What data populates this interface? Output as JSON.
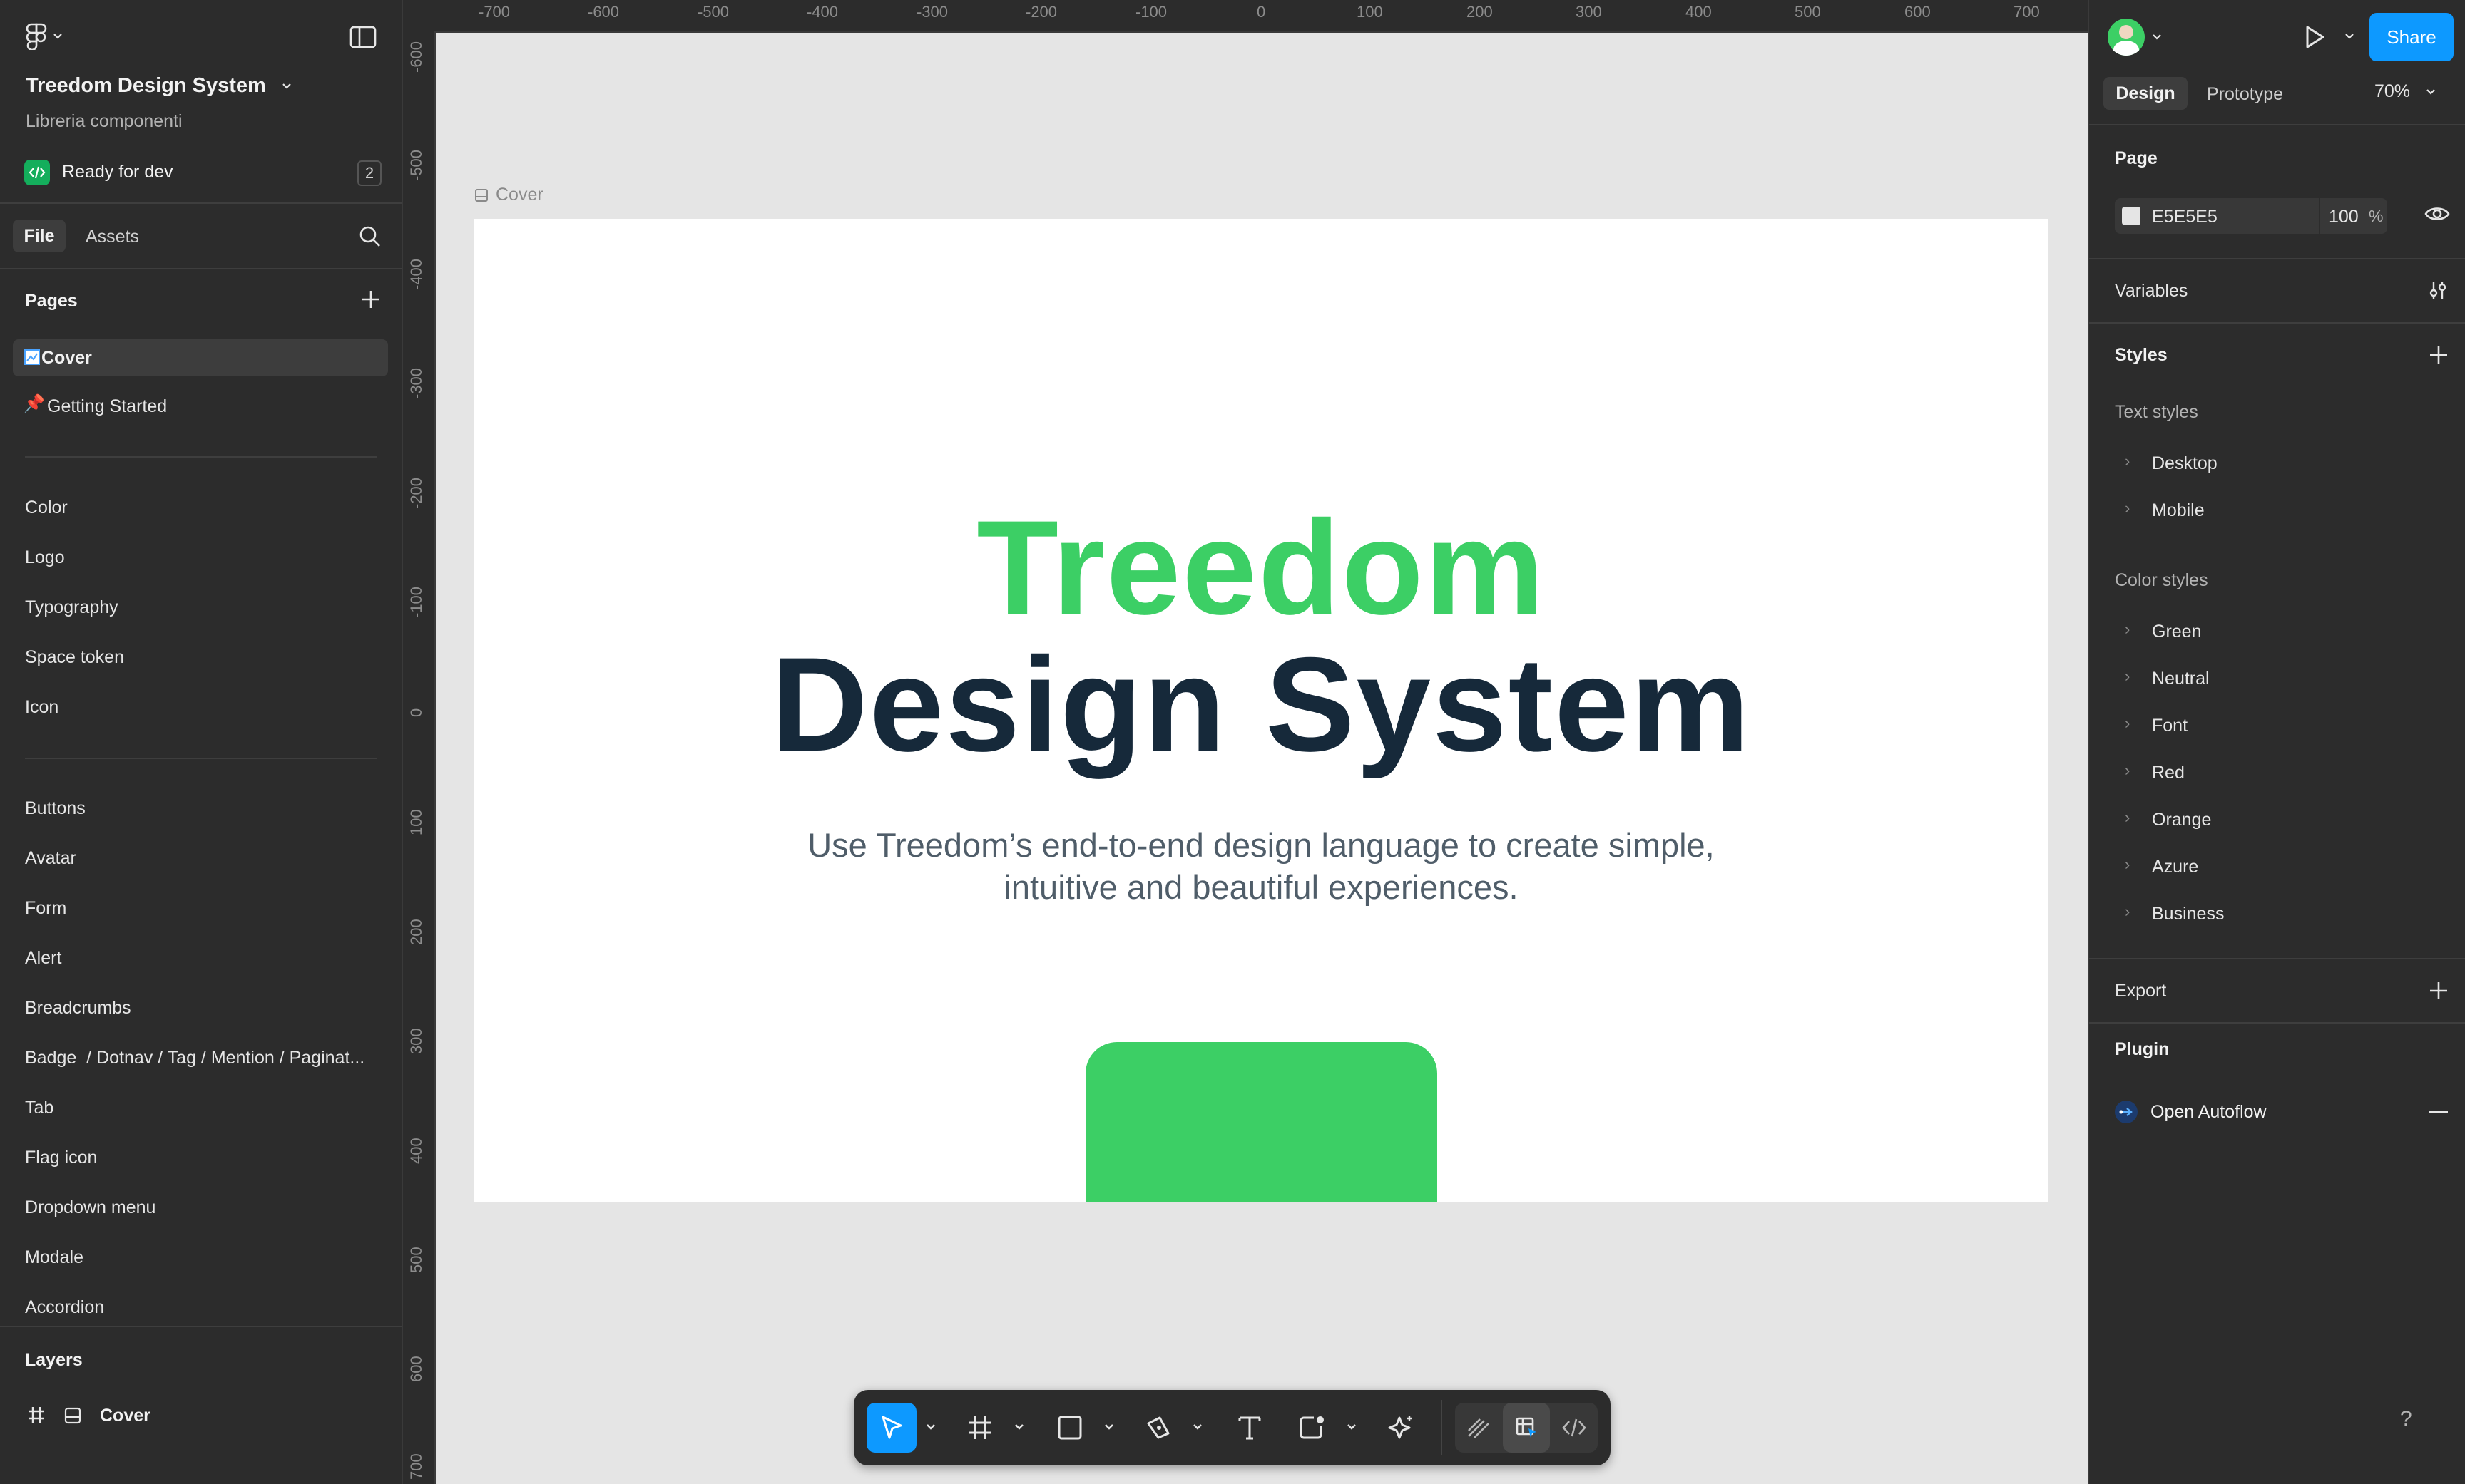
{
  "header": {
    "file_title": "Treedom Design System",
    "file_subtitle": "Libreria componenti",
    "ready_for_dev": "Ready for dev",
    "ready_count": "2"
  },
  "left_tabs": {
    "file": "File",
    "assets": "Assets"
  },
  "pages": {
    "title": "Pages",
    "current": "Cover",
    "getting_started": "Getting Started",
    "group1": [
      "Color",
      "Logo",
      "Typography",
      "Space token",
      "Icon"
    ],
    "group2": [
      "Buttons",
      "Avatar",
      "Form",
      "Alert",
      "Breadcrumbs",
      "Badge  / Dotnav / Tag / Mention / Paginat...",
      "Tab",
      "Flag icon",
      "Dropdown menu",
      "Modale",
      "Accordion"
    ]
  },
  "layers": {
    "title": "Layers",
    "item": "Cover"
  },
  "ruler": {
    "top": [
      "-700",
      "-600",
      "-500",
      "-400",
      "-300",
      "-200",
      "-100",
      "0",
      "100",
      "200",
      "300",
      "400",
      "500",
      "600",
      "700"
    ],
    "left": [
      "-600",
      "-500",
      "-400",
      "-300",
      "-200",
      "-100",
      "0",
      "100",
      "200",
      "300",
      "400",
      "500",
      "600",
      "700"
    ]
  },
  "canvas": {
    "frame_label": "Cover",
    "title_green": "Treedom",
    "title_dark": "Design System",
    "description_line1": "Use Treedom’s end-to-end design language to create simple,",
    "description_line2": "intuitive and beautiful experiences."
  },
  "right_panel": {
    "tabs": {
      "design": "Design",
      "prototype": "Prototype"
    },
    "zoom": "70%",
    "share": "Share",
    "page_section": "Page",
    "page_color": "E5E5E5",
    "page_opacity": "100",
    "percent": "%",
    "variables": "Variables",
    "styles": "Styles",
    "text_styles": "Text styles",
    "text_style_items": [
      "Desktop",
      "Mobile"
    ],
    "color_styles": "Color styles",
    "color_style_items": [
      "Green",
      "Neutral",
      "Font",
      "Red",
      "Orange",
      "Azure",
      "Business"
    ],
    "export": "Export",
    "plugin": "Plugin",
    "plugin_item": "Open Autoflow",
    "help": "?"
  },
  "colors": {
    "brand_green": "#3ccf65",
    "dark_navy": "#16293a",
    "accent_blue": "#0d99ff",
    "panel_bg": "#2c2c2c",
    "canvas_bg": "#e5e5e5"
  },
  "icons": [
    "figma-menu-icon",
    "sidebar-toggle-icon",
    "dev-mode-icon",
    "search-icon",
    "plus-icon",
    "frame-icon",
    "pin-icon",
    "hash-icon",
    "avatar",
    "play-icon",
    "chevron-down-icon",
    "eye-icon",
    "variables-icon",
    "move-tool-icon",
    "frame-tool-icon",
    "rectangle-tool-icon",
    "pen-tool-icon",
    "text-tool-icon",
    "shape-tool-icon",
    "ai-tool-icon",
    "draw-icon",
    "dev-mode-toggle-icon",
    "code-icon",
    "autoflow-icon",
    "minus-icon"
  ]
}
